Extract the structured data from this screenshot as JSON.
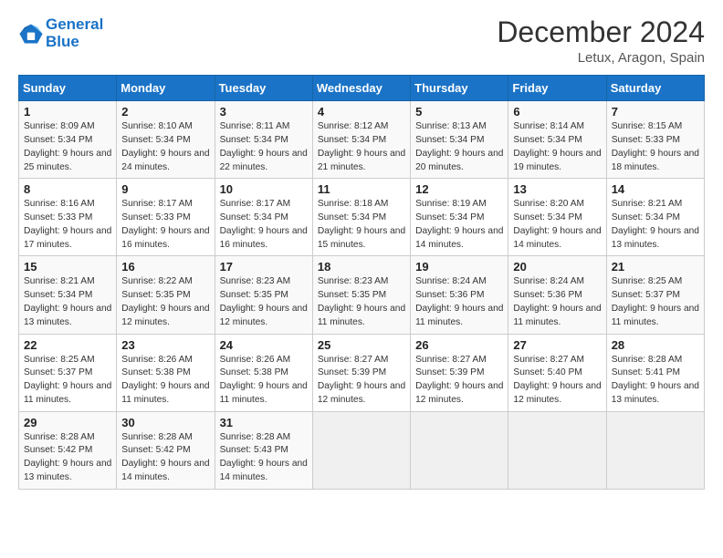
{
  "header": {
    "logo_line1": "General",
    "logo_line2": "Blue",
    "month": "December 2024",
    "location": "Letux, Aragon, Spain"
  },
  "weekdays": [
    "Sunday",
    "Monday",
    "Tuesday",
    "Wednesday",
    "Thursday",
    "Friday",
    "Saturday"
  ],
  "weeks": [
    [
      {
        "day": "1",
        "sunrise": "Sunrise: 8:09 AM",
        "sunset": "Sunset: 5:34 PM",
        "daylight": "Daylight: 9 hours and 25 minutes."
      },
      {
        "day": "2",
        "sunrise": "Sunrise: 8:10 AM",
        "sunset": "Sunset: 5:34 PM",
        "daylight": "Daylight: 9 hours and 24 minutes."
      },
      {
        "day": "3",
        "sunrise": "Sunrise: 8:11 AM",
        "sunset": "Sunset: 5:34 PM",
        "daylight": "Daylight: 9 hours and 22 minutes."
      },
      {
        "day": "4",
        "sunrise": "Sunrise: 8:12 AM",
        "sunset": "Sunset: 5:34 PM",
        "daylight": "Daylight: 9 hours and 21 minutes."
      },
      {
        "day": "5",
        "sunrise": "Sunrise: 8:13 AM",
        "sunset": "Sunset: 5:34 PM",
        "daylight": "Daylight: 9 hours and 20 minutes."
      },
      {
        "day": "6",
        "sunrise": "Sunrise: 8:14 AM",
        "sunset": "Sunset: 5:34 PM",
        "daylight": "Daylight: 9 hours and 19 minutes."
      },
      {
        "day": "7",
        "sunrise": "Sunrise: 8:15 AM",
        "sunset": "Sunset: 5:33 PM",
        "daylight": "Daylight: 9 hours and 18 minutes."
      }
    ],
    [
      {
        "day": "8",
        "sunrise": "Sunrise: 8:16 AM",
        "sunset": "Sunset: 5:33 PM",
        "daylight": "Daylight: 9 hours and 17 minutes."
      },
      {
        "day": "9",
        "sunrise": "Sunrise: 8:17 AM",
        "sunset": "Sunset: 5:33 PM",
        "daylight": "Daylight: 9 hours and 16 minutes."
      },
      {
        "day": "10",
        "sunrise": "Sunrise: 8:17 AM",
        "sunset": "Sunset: 5:34 PM",
        "daylight": "Daylight: 9 hours and 16 minutes."
      },
      {
        "day": "11",
        "sunrise": "Sunrise: 8:18 AM",
        "sunset": "Sunset: 5:34 PM",
        "daylight": "Daylight: 9 hours and 15 minutes."
      },
      {
        "day": "12",
        "sunrise": "Sunrise: 8:19 AM",
        "sunset": "Sunset: 5:34 PM",
        "daylight": "Daylight: 9 hours and 14 minutes."
      },
      {
        "day": "13",
        "sunrise": "Sunrise: 8:20 AM",
        "sunset": "Sunset: 5:34 PM",
        "daylight": "Daylight: 9 hours and 14 minutes."
      },
      {
        "day": "14",
        "sunrise": "Sunrise: 8:21 AM",
        "sunset": "Sunset: 5:34 PM",
        "daylight": "Daylight: 9 hours and 13 minutes."
      }
    ],
    [
      {
        "day": "15",
        "sunrise": "Sunrise: 8:21 AM",
        "sunset": "Sunset: 5:34 PM",
        "daylight": "Daylight: 9 hours and 13 minutes."
      },
      {
        "day": "16",
        "sunrise": "Sunrise: 8:22 AM",
        "sunset": "Sunset: 5:35 PM",
        "daylight": "Daylight: 9 hours and 12 minutes."
      },
      {
        "day": "17",
        "sunrise": "Sunrise: 8:23 AM",
        "sunset": "Sunset: 5:35 PM",
        "daylight": "Daylight: 9 hours and 12 minutes."
      },
      {
        "day": "18",
        "sunrise": "Sunrise: 8:23 AM",
        "sunset": "Sunset: 5:35 PM",
        "daylight": "Daylight: 9 hours and 11 minutes."
      },
      {
        "day": "19",
        "sunrise": "Sunrise: 8:24 AM",
        "sunset": "Sunset: 5:36 PM",
        "daylight": "Daylight: 9 hours and 11 minutes."
      },
      {
        "day": "20",
        "sunrise": "Sunrise: 8:24 AM",
        "sunset": "Sunset: 5:36 PM",
        "daylight": "Daylight: 9 hours and 11 minutes."
      },
      {
        "day": "21",
        "sunrise": "Sunrise: 8:25 AM",
        "sunset": "Sunset: 5:37 PM",
        "daylight": "Daylight: 9 hours and 11 minutes."
      }
    ],
    [
      {
        "day": "22",
        "sunrise": "Sunrise: 8:25 AM",
        "sunset": "Sunset: 5:37 PM",
        "daylight": "Daylight: 9 hours and 11 minutes."
      },
      {
        "day": "23",
        "sunrise": "Sunrise: 8:26 AM",
        "sunset": "Sunset: 5:38 PM",
        "daylight": "Daylight: 9 hours and 11 minutes."
      },
      {
        "day": "24",
        "sunrise": "Sunrise: 8:26 AM",
        "sunset": "Sunset: 5:38 PM",
        "daylight": "Daylight: 9 hours and 11 minutes."
      },
      {
        "day": "25",
        "sunrise": "Sunrise: 8:27 AM",
        "sunset": "Sunset: 5:39 PM",
        "daylight": "Daylight: 9 hours and 12 minutes."
      },
      {
        "day": "26",
        "sunrise": "Sunrise: 8:27 AM",
        "sunset": "Sunset: 5:39 PM",
        "daylight": "Daylight: 9 hours and 12 minutes."
      },
      {
        "day": "27",
        "sunrise": "Sunrise: 8:27 AM",
        "sunset": "Sunset: 5:40 PM",
        "daylight": "Daylight: 9 hours and 12 minutes."
      },
      {
        "day": "28",
        "sunrise": "Sunrise: 8:28 AM",
        "sunset": "Sunset: 5:41 PM",
        "daylight": "Daylight: 9 hours and 13 minutes."
      }
    ],
    [
      {
        "day": "29",
        "sunrise": "Sunrise: 8:28 AM",
        "sunset": "Sunset: 5:42 PM",
        "daylight": "Daylight: 9 hours and 13 minutes."
      },
      {
        "day": "30",
        "sunrise": "Sunrise: 8:28 AM",
        "sunset": "Sunset: 5:42 PM",
        "daylight": "Daylight: 9 hours and 14 minutes."
      },
      {
        "day": "31",
        "sunrise": "Sunrise: 8:28 AM",
        "sunset": "Sunset: 5:43 PM",
        "daylight": "Daylight: 9 hours and 14 minutes."
      },
      null,
      null,
      null,
      null
    ]
  ]
}
